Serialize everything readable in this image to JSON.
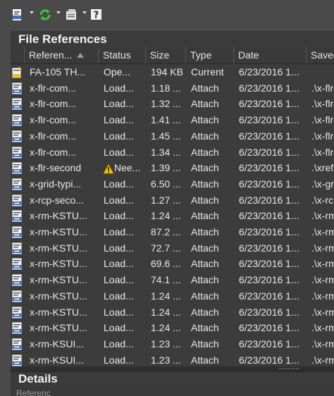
{
  "palette": {
    "bg": "#4a4a4a",
    "panel": "#3c3c3c",
    "header": "#3b3b3b",
    "text": "#e8e8e8",
    "warning": "#f2c400"
  },
  "toolbar": {
    "buttons": [
      {
        "name": "attach-dwg-button",
        "icon": "attach-dwg-icon",
        "has_dropdown": true
      },
      {
        "name": "refresh-button",
        "icon": "refresh-icon",
        "has_dropdown": true
      },
      {
        "name": "change-path-button",
        "icon": "change-path-icon",
        "has_dropdown": true
      },
      {
        "name": "help-button",
        "icon": "help-icon",
        "has_dropdown": false
      }
    ]
  },
  "sections": {
    "file_references": "File References",
    "details": "Details"
  },
  "columns": [
    {
      "key": "name",
      "label": "Referen...",
      "sorted": "asc"
    },
    {
      "key": "status",
      "label": "Status"
    },
    {
      "key": "size",
      "label": "Size"
    },
    {
      "key": "type",
      "label": "Type"
    },
    {
      "key": "date",
      "label": "Date"
    },
    {
      "key": "path",
      "label": "Saved P"
    }
  ],
  "rows": [
    {
      "icon": "master-drawing-icon",
      "name": "FA-105 TH...",
      "status": "Ope...",
      "size": "194 KB",
      "type": "Current",
      "date": "6/23/2016 1...",
      "path": ""
    },
    {
      "icon": "dwg-file-icon",
      "name": "x-flr-com...",
      "status": "Load...",
      "size": "1.18 ...",
      "type": "Attach",
      "date": "6/23/2016 1...",
      "path": ".\\x-flr-co"
    },
    {
      "icon": "dwg-file-icon",
      "name": "x-flr-com...",
      "status": "Load...",
      "size": "1.32 ...",
      "type": "Attach",
      "date": "6/23/2016 1...",
      "path": ".\\x-flr-co"
    },
    {
      "icon": "dwg-file-icon",
      "name": "x-flr-com...",
      "status": "Load...",
      "size": "1.41 ...",
      "type": "Attach",
      "date": "6/23/2016 1...",
      "path": ".\\x-flr-co"
    },
    {
      "icon": "dwg-file-icon",
      "name": "x-flr-com...",
      "status": "Load...",
      "size": "1.45 ...",
      "type": "Attach",
      "date": "6/23/2016 1...",
      "path": ".\\x-flr-co"
    },
    {
      "icon": "dwg-file-icon",
      "name": "x-flr-com...",
      "status": "Load...",
      "size": "1.34 ...",
      "type": "Attach",
      "date": "6/23/2016 1...",
      "path": ".\\x-flr-co"
    },
    {
      "icon": "dwg-file-icon",
      "name": "x-flr-second",
      "status": "Nee...",
      "warning": true,
      "size": "1.39 ...",
      "type": "Attach",
      "date": "6/23/2016 1...",
      "path": ".\\xrefs\\x"
    },
    {
      "icon": "dwg-file-icon",
      "name": "x-grid-typi...",
      "status": "Load...",
      "size": "6.50 ...",
      "type": "Attach",
      "date": "6/23/2016 1...",
      "path": ".\\x-grid-"
    },
    {
      "icon": "dwg-file-icon",
      "name": "x-rcp-seco...",
      "status": "Load...",
      "size": "1.27 ...",
      "type": "Attach",
      "date": "6/23/2016 1...",
      "path": ".\\x-rcp-s"
    },
    {
      "icon": "dwg-file-icon",
      "name": "x-rm-KSTU...",
      "status": "Load...",
      "size": "1.24 ...",
      "type": "Attach",
      "date": "6/23/2016 1...",
      "path": ".\\x-rm-K"
    },
    {
      "icon": "dwg-file-icon",
      "name": "x-rm-KSTU...",
      "status": "Load...",
      "size": "87.2 ...",
      "type": "Attach",
      "date": "6/23/2016 1...",
      "path": ".\\x-rm-K"
    },
    {
      "icon": "dwg-file-icon",
      "name": "x-rm-KSTU...",
      "status": "Load...",
      "size": "72.7 ...",
      "type": "Attach",
      "date": "6/23/2016 1...",
      "path": ".\\x-rm-K"
    },
    {
      "icon": "dwg-file-icon",
      "name": "x-rm-KSTU...",
      "status": "Load...",
      "size": "69.6 ...",
      "type": "Attach",
      "date": "6/23/2016 1...",
      "path": ".\\x-rm-K"
    },
    {
      "icon": "dwg-file-icon",
      "name": "x-rm-KSTU...",
      "status": "Load...",
      "size": "74.1 ...",
      "type": "Attach",
      "date": "6/23/2016 1...",
      "path": ".\\x-rm-K"
    },
    {
      "icon": "dwg-file-icon",
      "name": "x-rm-KSTU...",
      "status": "Load...",
      "size": "1.24 ...",
      "type": "Attach",
      "date": "6/23/2016 1...",
      "path": ".\\x-rm-K"
    },
    {
      "icon": "dwg-file-icon",
      "name": "x-rm-KSTU...",
      "status": "Load...",
      "size": "1.24 ...",
      "type": "Attach",
      "date": "6/23/2016 1...",
      "path": ".\\x-rm-K"
    },
    {
      "icon": "dwg-file-icon",
      "name": "x-rm-KSTU...",
      "status": "Load...",
      "size": "1.24 ...",
      "type": "Attach",
      "date": "6/23/2016 1...",
      "path": ".\\x-rm-K"
    },
    {
      "icon": "dwg-file-icon",
      "name": "x-rm-KSUI...",
      "status": "Load...",
      "size": "1.23 ...",
      "type": "Attach",
      "date": "6/23/2016 1...",
      "path": ".\\x-rm-K"
    },
    {
      "icon": "dwg-file-icon",
      "name": "x-rm-KSUI...",
      "status": "Load...",
      "size": "1.23 ...",
      "type": "Attach",
      "date": "6/23/2016 1...",
      "path": ".\\x-rm-K"
    }
  ],
  "details": {
    "first_label": "Referenc"
  }
}
